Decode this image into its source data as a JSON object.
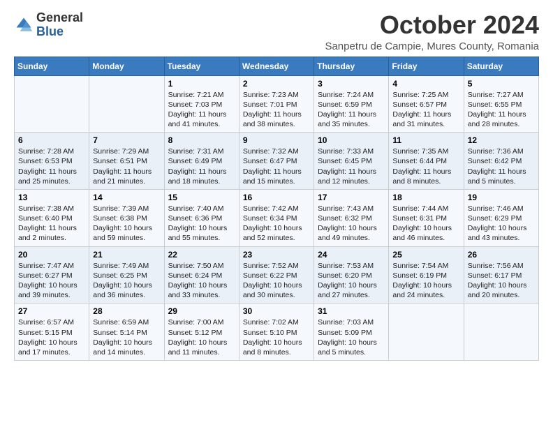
{
  "logo": {
    "general": "General",
    "blue": "Blue"
  },
  "header": {
    "month": "October 2024",
    "location": "Sanpetru de Campie, Mures County, Romania"
  },
  "weekdays": [
    "Sunday",
    "Monday",
    "Tuesday",
    "Wednesday",
    "Thursday",
    "Friday",
    "Saturday"
  ],
  "weeks": [
    [
      null,
      null,
      {
        "day": 1,
        "sunrise": "7:21 AM",
        "sunset": "7:03 PM",
        "daylight": "11 hours and 41 minutes."
      },
      {
        "day": 2,
        "sunrise": "7:23 AM",
        "sunset": "7:01 PM",
        "daylight": "11 hours and 38 minutes."
      },
      {
        "day": 3,
        "sunrise": "7:24 AM",
        "sunset": "6:59 PM",
        "daylight": "11 hours and 35 minutes."
      },
      {
        "day": 4,
        "sunrise": "7:25 AM",
        "sunset": "6:57 PM",
        "daylight": "11 hours and 31 minutes."
      },
      {
        "day": 5,
        "sunrise": "7:27 AM",
        "sunset": "6:55 PM",
        "daylight": "11 hours and 28 minutes."
      }
    ],
    [
      {
        "day": 6,
        "sunrise": "7:28 AM",
        "sunset": "6:53 PM",
        "daylight": "11 hours and 25 minutes."
      },
      {
        "day": 7,
        "sunrise": "7:29 AM",
        "sunset": "6:51 PM",
        "daylight": "11 hours and 21 minutes."
      },
      {
        "day": 8,
        "sunrise": "7:31 AM",
        "sunset": "6:49 PM",
        "daylight": "11 hours and 18 minutes."
      },
      {
        "day": 9,
        "sunrise": "7:32 AM",
        "sunset": "6:47 PM",
        "daylight": "11 hours and 15 minutes."
      },
      {
        "day": 10,
        "sunrise": "7:33 AM",
        "sunset": "6:45 PM",
        "daylight": "11 hours and 12 minutes."
      },
      {
        "day": 11,
        "sunrise": "7:35 AM",
        "sunset": "6:44 PM",
        "daylight": "11 hours and 8 minutes."
      },
      {
        "day": 12,
        "sunrise": "7:36 AM",
        "sunset": "6:42 PM",
        "daylight": "11 hours and 5 minutes."
      }
    ],
    [
      {
        "day": 13,
        "sunrise": "7:38 AM",
        "sunset": "6:40 PM",
        "daylight": "11 hours and 2 minutes."
      },
      {
        "day": 14,
        "sunrise": "7:39 AM",
        "sunset": "6:38 PM",
        "daylight": "10 hours and 59 minutes."
      },
      {
        "day": 15,
        "sunrise": "7:40 AM",
        "sunset": "6:36 PM",
        "daylight": "10 hours and 55 minutes."
      },
      {
        "day": 16,
        "sunrise": "7:42 AM",
        "sunset": "6:34 PM",
        "daylight": "10 hours and 52 minutes."
      },
      {
        "day": 17,
        "sunrise": "7:43 AM",
        "sunset": "6:32 PM",
        "daylight": "10 hours and 49 minutes."
      },
      {
        "day": 18,
        "sunrise": "7:44 AM",
        "sunset": "6:31 PM",
        "daylight": "10 hours and 46 minutes."
      },
      {
        "day": 19,
        "sunrise": "7:46 AM",
        "sunset": "6:29 PM",
        "daylight": "10 hours and 43 minutes."
      }
    ],
    [
      {
        "day": 20,
        "sunrise": "7:47 AM",
        "sunset": "6:27 PM",
        "daylight": "10 hours and 39 minutes."
      },
      {
        "day": 21,
        "sunrise": "7:49 AM",
        "sunset": "6:25 PM",
        "daylight": "10 hours and 36 minutes."
      },
      {
        "day": 22,
        "sunrise": "7:50 AM",
        "sunset": "6:24 PM",
        "daylight": "10 hours and 33 minutes."
      },
      {
        "day": 23,
        "sunrise": "7:52 AM",
        "sunset": "6:22 PM",
        "daylight": "10 hours and 30 minutes."
      },
      {
        "day": 24,
        "sunrise": "7:53 AM",
        "sunset": "6:20 PM",
        "daylight": "10 hours and 27 minutes."
      },
      {
        "day": 25,
        "sunrise": "7:54 AM",
        "sunset": "6:19 PM",
        "daylight": "10 hours and 24 minutes."
      },
      {
        "day": 26,
        "sunrise": "7:56 AM",
        "sunset": "6:17 PM",
        "daylight": "10 hours and 20 minutes."
      }
    ],
    [
      {
        "day": 27,
        "sunrise": "6:57 AM",
        "sunset": "5:15 PM",
        "daylight": "10 hours and 17 minutes."
      },
      {
        "day": 28,
        "sunrise": "6:59 AM",
        "sunset": "5:14 PM",
        "daylight": "10 hours and 14 minutes."
      },
      {
        "day": 29,
        "sunrise": "7:00 AM",
        "sunset": "5:12 PM",
        "daylight": "10 hours and 11 minutes."
      },
      {
        "day": 30,
        "sunrise": "7:02 AM",
        "sunset": "5:10 PM",
        "daylight": "10 hours and 8 minutes."
      },
      {
        "day": 31,
        "sunrise": "7:03 AM",
        "sunset": "5:09 PM",
        "daylight": "10 hours and 5 minutes."
      },
      null,
      null
    ]
  ]
}
